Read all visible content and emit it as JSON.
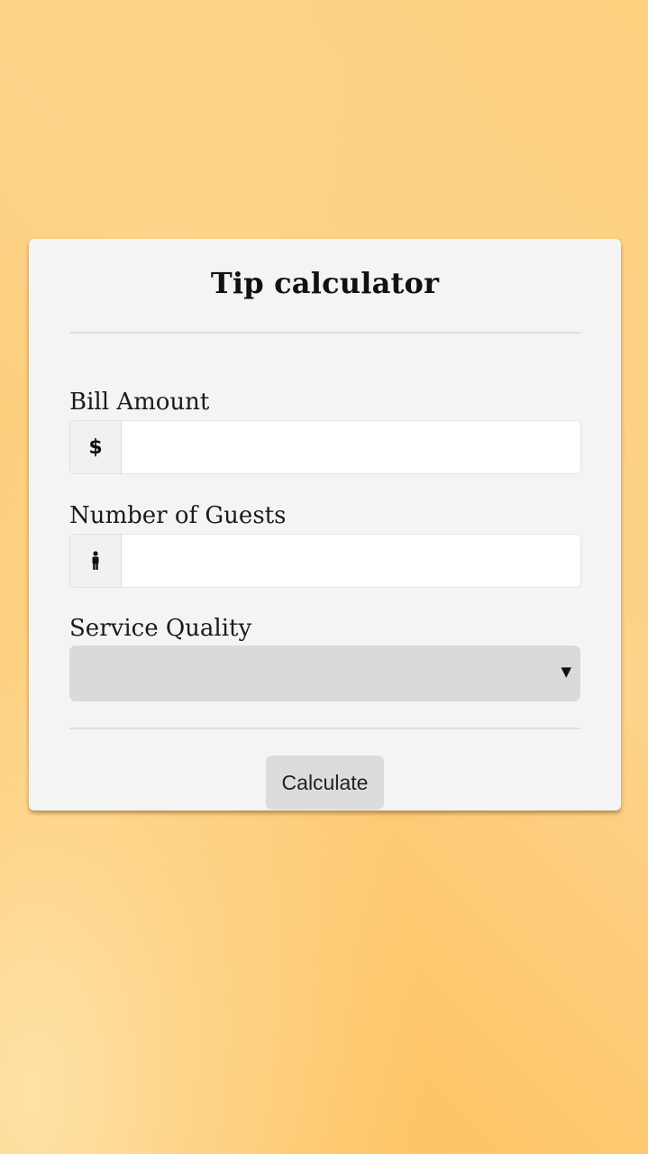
{
  "card": {
    "title": "Tip calculator"
  },
  "bill": {
    "label": "Bill Amount",
    "prefix_symbol": "$",
    "value": "",
    "icon": "dollar-icon"
  },
  "guests": {
    "label": "Number of Guests",
    "value": "",
    "icon": "person-icon"
  },
  "service": {
    "label": "Service Quality",
    "selected": "",
    "icon": "caret-down-icon"
  },
  "actions": {
    "calculate_label": "Calculate"
  },
  "colors": {
    "background_from": "#fdd28a",
    "background_to": "#fdbd55",
    "card": "#f4f4f4",
    "button": "#dcdcdc",
    "select": "#dadada"
  }
}
